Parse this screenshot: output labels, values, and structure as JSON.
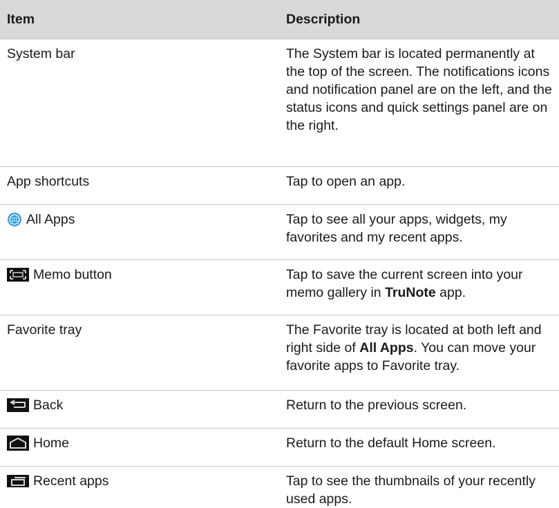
{
  "headers": {
    "item": "Item",
    "description": "Description"
  },
  "rows": [
    {
      "item": "System bar",
      "description": "The System bar is located permanently at the top of the screen. The notifications icons and notification panel are on the left, and the status icons and quick settings panel are on the right."
    },
    {
      "item": "App shortcuts",
      "description": "Tap to open an app."
    },
    {
      "item": "All Apps",
      "icon": "all-apps-icon",
      "description": "Tap to see all your apps, widgets, my favorites and my recent apps."
    },
    {
      "item": "Memo button",
      "icon": "memo-icon",
      "description_pre": "Tap to save the current screen into your memo gallery in ",
      "description_bold": "TruNote",
      "description_post": " app."
    },
    {
      "item": "Favorite tray",
      "description_pre": "The Favorite tray is located at both left and right side of ",
      "description_bold": "All Apps",
      "description_post": ". You can move your favorite apps to Favorite tray."
    },
    {
      "item": "Back",
      "icon": "back-icon",
      "description": "Return to the previous screen."
    },
    {
      "item": "Home",
      "icon": "home-icon",
      "description": "Return to the default Home screen."
    },
    {
      "item": "Recent apps",
      "icon": "recent-apps-icon",
      "description": "Tap to see the thumbnails of your recently used apps."
    }
  ],
  "colors": {
    "header_bg": "#d9d9d9",
    "divider": "#c8c8c8",
    "icon_bg": "#111111",
    "all_apps_icon": "#3aa0e0"
  }
}
